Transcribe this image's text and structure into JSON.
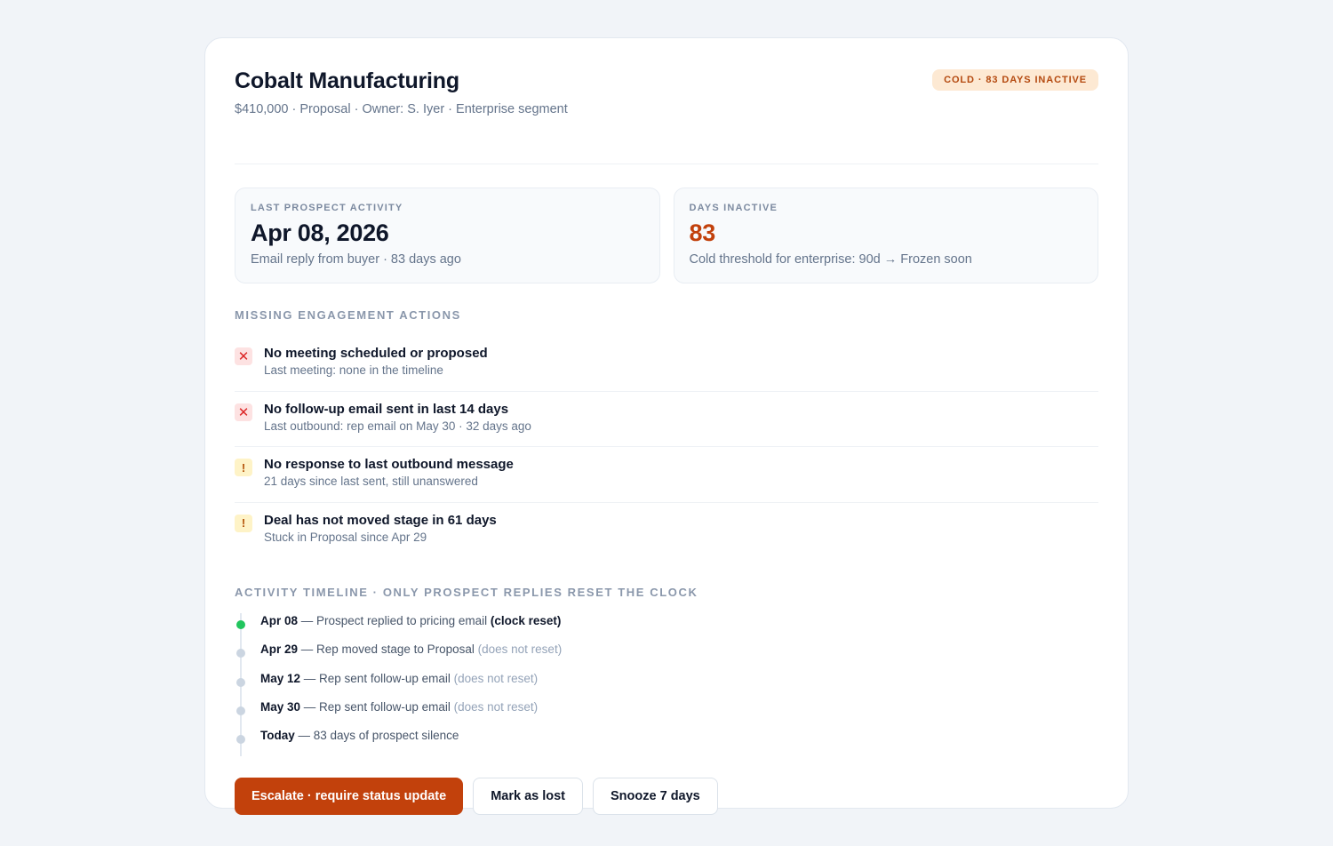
{
  "deal": {
    "name": "Cobalt Manufacturing",
    "summary": "$410,000 · Proposal · Owner: S. Iyer · Enterprise segment",
    "badge": "COLD · 83 DAYS INACTIVE"
  },
  "stats": [
    {
      "label": "LAST PROSPECT ACTIVITY",
      "value": "Apr 08, 2026",
      "note": "Email reply from buyer · 83 days ago"
    },
    {
      "label": "DAYS INACTIVE",
      "value": "83",
      "note": "Cold threshold for enterprise: 90d → Frozen soon"
    }
  ],
  "missing": {
    "title": "MISSING ENGAGEMENT ACTIONS",
    "items": [
      {
        "icon": "x-icon",
        "glyph": "✕",
        "title": "No meeting scheduled or proposed",
        "sub": "Last meeting: none in the timeline"
      },
      {
        "icon": "x-icon",
        "glyph": "✕",
        "title": "No follow-up email sent in last 14 days",
        "sub": "Last outbound: rep email on May 30 · 32 days ago"
      },
      {
        "icon": "warning-icon",
        "glyph": "!",
        "title": "No response to last outbound message",
        "sub": "21 days since last sent, still unanswered"
      },
      {
        "icon": "warning-icon",
        "glyph": "!",
        "title": "Deal has not moved stage in 61 days",
        "sub": "Stuck in Proposal since Apr 29"
      }
    ]
  },
  "timeline": {
    "title": "ACTIVITY TIMELINE · ONLY PROSPECT REPLIES RESET THE CLOCK",
    "items": [
      {
        "date": "Apr 08",
        "text": " — Prospect replied to pricing email ",
        "strong": "(clock reset)",
        "muted": ""
      },
      {
        "date": "Apr 29",
        "text": " — Rep moved stage to Proposal ",
        "strong": "",
        "muted": "(does not reset)"
      },
      {
        "date": "May 12",
        "text": " — Rep sent follow-up email ",
        "strong": "",
        "muted": "(does not reset)"
      },
      {
        "date": "May 30",
        "text": " — Rep sent follow-up email ",
        "strong": "",
        "muted": "(does not reset)"
      },
      {
        "date": "Today",
        "text": " — 83 days of prospect silence",
        "strong": "",
        "muted": ""
      }
    ]
  },
  "buttons": {
    "escalate": "Escalate · require status update",
    "lost": "Mark as lost",
    "snooze": "Snooze 7 days"
  },
  "colors": {
    "accent": "#c2410c",
    "badge_bg": "#fde9d3",
    "reset_dot": "#22c55e",
    "neutral_dot": "#cbd5e1"
  }
}
